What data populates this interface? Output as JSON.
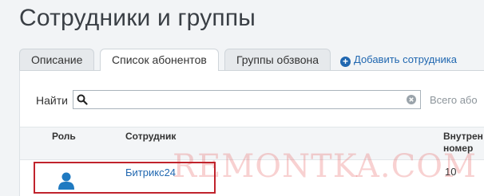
{
  "page": {
    "title": "Сотрудники и группы"
  },
  "tabs": [
    {
      "label": "Описание",
      "active": false
    },
    {
      "label": "Список абонентов",
      "active": true
    },
    {
      "label": "Группы обзвона",
      "active": false
    }
  ],
  "add_employee": {
    "label": "Добавить сотрудника",
    "icon": "plus-circle-icon"
  },
  "search": {
    "label": "Найти",
    "value": "",
    "placeholder": "",
    "total_text": "Всего або"
  },
  "table": {
    "headers": {
      "role": "Роль",
      "employee": "Сотрудник",
      "ext_line1": "Внутрен",
      "ext_line2": "номер"
    },
    "rows": [
      {
        "role_icon": "user-icon",
        "employee": "Битрикс24",
        "extension": "10"
      }
    ]
  },
  "watermark": "REMONTKA.COM",
  "colors": {
    "link": "#2067b0",
    "highlight": "#c0232c",
    "role_icon": "#1f7ac1"
  }
}
